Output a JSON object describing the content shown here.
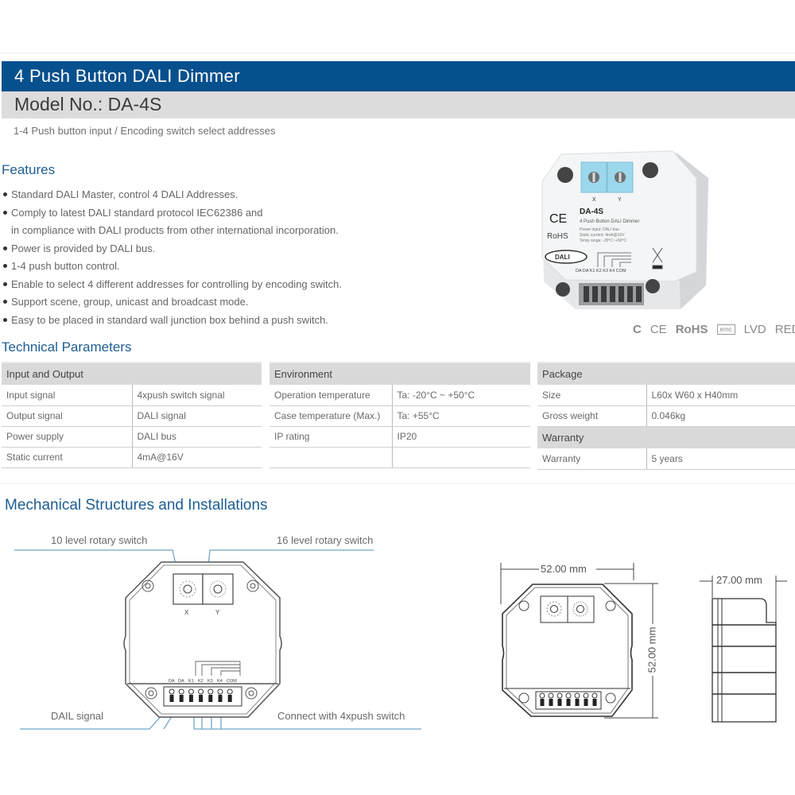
{
  "header": {
    "title": "4 Push Button DALI Dimmer",
    "model": "Model No.: DA-4S",
    "subtitle": "1-4 Push button input / Encoding switch select addresses"
  },
  "features": {
    "title": "Features",
    "items": [
      {
        "text": "Standard DALI Master, control 4 DALI Addresses.",
        "bullet": true
      },
      {
        "text": "Comply to latest DALI standard protocol IEC62386 and",
        "bullet": true
      },
      {
        "text": "in compliance with DALI products from other international incorporation.",
        "bullet": false
      },
      {
        "text": "Power is provided by DALI bus.",
        "bullet": true
      },
      {
        "text": "1-4 push button control.",
        "bullet": true
      },
      {
        "text": "Enable to select 4 different addresses for controlling by encoding switch.",
        "bullet": true
      },
      {
        "text": "Support scene, group, unicast and broadcast mode.",
        "bullet": true
      },
      {
        "text": "Easy to be placed in standard wall junction box behind a push switch.",
        "bullet": true
      }
    ]
  },
  "product_photo": {
    "switch_x": "X",
    "switch_y": "Y",
    "model": "DA-4S",
    "name": "4 Push Button DALI Dimmer",
    "lines": [
      "Power input: DALI bus",
      "Static current: 4mA@16V",
      "Temp range: -20°C~+50°C"
    ],
    "ce": "CE",
    "rohs": "RoHS",
    "dali": "DALI",
    "terminals": "DA DA K1 K2 K3 K4 COM"
  },
  "certifications": [
    "C",
    "CE",
    "RoHS",
    "emc",
    "LVD",
    "RED"
  ],
  "technical": {
    "title": "Technical Parameters",
    "input_output": {
      "header": "Input and Output",
      "rows": [
        [
          "Input signal",
          "4xpush switch signal"
        ],
        [
          "Output signal",
          "DALI signal"
        ],
        [
          "Power supply",
          "DALI bus"
        ],
        [
          "Static current",
          "4mA@16V"
        ]
      ]
    },
    "environment": {
      "header": "Environment",
      "rows": [
        [
          "Operation temperature",
          "Ta: -20°C ~ +50°C"
        ],
        [
          "Case temperature (Max.)",
          "Ta: +55°C"
        ],
        [
          "IP rating",
          "IP20"
        ],
        [
          "",
          ""
        ]
      ]
    },
    "package": {
      "header": "Package",
      "rows": [
        [
          "Size",
          "L60x W60 x H40mm"
        ],
        [
          "Gross weight",
          "0.046kg"
        ]
      ]
    },
    "warranty": {
      "header": "Warranty",
      "rows": [
        [
          "Warranty",
          "5 years"
        ]
      ]
    }
  },
  "mechanical": {
    "title": "Mechanical Structures and Installations",
    "label_10_level": "10 level rotary switch",
    "label_16_level": "16 level rotary switch",
    "label_dali_signal": "DAIL signal",
    "label_push_switch": "Connect with 4xpush switch",
    "switch_x": "X",
    "switch_y": "Y",
    "terminals": [
      "DA",
      "DA",
      "K1",
      "K2",
      "K3",
      "K4",
      "COM"
    ],
    "width_dim": "52.00 mm",
    "height_dim": "52.00 mm",
    "depth_dim": "27.00 mm"
  }
}
